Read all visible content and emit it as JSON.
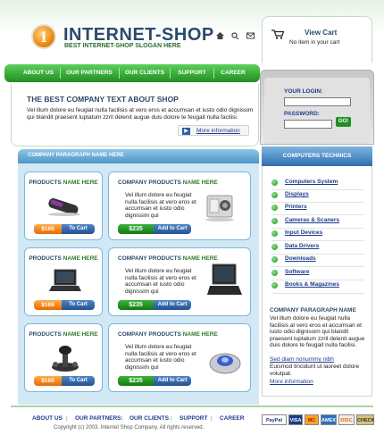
{
  "header": {
    "logo_letter": "i",
    "title": "INTERNET-SHOP",
    "slogan": "BEST INTERNET-SHOP SLOGAN HERE",
    "icons": [
      "home-icon",
      "search-icon",
      "mail-icon"
    ]
  },
  "cart": {
    "title": "View Cart",
    "status": "No item in your cart"
  },
  "nav": {
    "items": [
      "ABOUT US",
      "OUR PARTNERS",
      "OUR CLIENTS",
      "SUPPORT",
      "CAREER"
    ]
  },
  "login": {
    "login_label": "YOUR LOGIN:",
    "password_label": "PASSWORD:",
    "login_value": "",
    "password_value": "",
    "go_label": "GO!"
  },
  "intro": {
    "title": "THE BEST COMPANY TEXT ABOUT SHOP",
    "text": "Vel illum dolore eu feugiat nulla facilisis at vero eros et accumsan et iusto odio dignissim qui blandit praesent luptatum zzril delenit augue duis dolore te feugait nulla facilisi.",
    "more": "More information"
  },
  "center": {
    "bar_title": "COMPANY PARAGRAPH NAME HERE",
    "products_left": [
      {
        "title_a": "PRODUCTS",
        "title_b": "NAME HERE",
        "price": "$165",
        "cart": "To Cart"
      },
      {
        "title_a": "PRODUCTS",
        "title_b": "NAME HERE",
        "price": "$165",
        "cart": "To Cart"
      },
      {
        "title_a": "PRODUCTS",
        "title_b": "NAME HERE",
        "price": "$165",
        "cart": "To Cart"
      }
    ],
    "products_right": [
      {
        "title_a": "COMPANY PRODUCTS",
        "title_b": "NAME HERE",
        "desc": "Vel illum dolore eu feugiat nulla facilisis at vero eros et accumsan et iusto odio dignissim qui",
        "price": "$235",
        "cart": "Add to Cart"
      },
      {
        "title_a": "COMPANY PRODUCTS",
        "title_b": "NAME HERE",
        "desc": "Vel illum dolore eu feugiat nulla facilisis at vero eros et accumsan et iusto odio dignissim qui",
        "price": "$235",
        "cart": "Add to Cart"
      },
      {
        "title_a": "COMPANY PRODUCTS",
        "title_b": "NAME HERE",
        "desc": "Vel illum dolore eu feugiat nulla facilisis at vero eros et accumsan et iusto odio dignissim qui",
        "price": "$235",
        "cart": "Add to Cart"
      }
    ]
  },
  "sidebar": {
    "heading": "COMPUTERS TECHNICS",
    "categories": [
      "Computers System",
      "Displays",
      "Printers",
      "Cameras & Scaners",
      "Input Devices",
      "Data Drivers",
      "Downloads",
      "Software",
      "Books & Magazines"
    ],
    "paragraph_title": "COMPANY PARAGRAPH NAME",
    "paragraph_text": "Vel illum dolore eu feugiat nulla facilisis at vero eros et accumsan et iusto odio dignissim qui blandit praesent luptatum zzril delenit augue duis dolore te feugait nulla facilisi.",
    "link": "Sed diam nonummy nibh",
    "text2": "Euismod tincidunt ut laoreet dolore volutpat.",
    "more": "More information"
  },
  "footer": {
    "nav": [
      "ABOUT US",
      "OUR PARTNERS",
      "OUR CLIENTS",
      "SUPPORT",
      "CAREER"
    ],
    "copyright": "Copyright (c) 2003. Internet Shop Company. All rights reserved.",
    "payments": [
      "PayPal",
      "VISA",
      "MC",
      "AMEX",
      "DISC",
      "CHECK"
    ]
  },
  "colors": {
    "brand_green": "#1f8f1f",
    "title_blue": "#2c4a6b",
    "accent_orange": "#e56a00"
  }
}
